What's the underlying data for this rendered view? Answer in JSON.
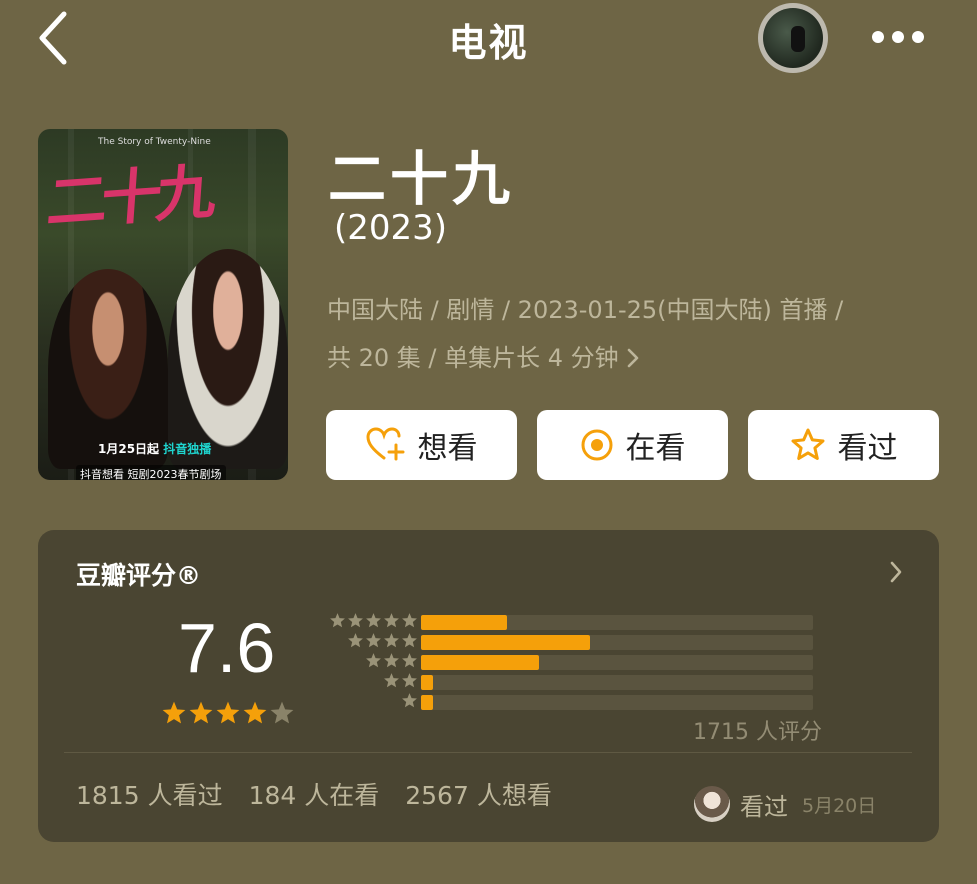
{
  "header": {
    "title": "电视",
    "back_icon": "chevron-left-icon",
    "more_icon": "ellipsis-icon"
  },
  "poster": {
    "title_art": "二十九",
    "subtitle": "The Story of Twenty-Nine",
    "release_text": "1月25日起",
    "platform_text": "抖音独播",
    "bottom_text": "抖音想看  短剧2023春节剧场"
  },
  "show": {
    "title": "二十九",
    "year": "(2023)",
    "meta_line1": "中国大陆 / 剧情 / 2023-01-25(中国大陆) 首播 /",
    "meta_line2": "共 20 集 / 单集片长 4 分钟"
  },
  "actions": [
    {
      "label": "想看",
      "icon": "heart-plus-icon"
    },
    {
      "label": "在看",
      "icon": "target-icon"
    },
    {
      "label": "看过",
      "icon": "star-outline-icon"
    }
  ],
  "rating": {
    "title": "豆瓣评分®",
    "score": "7.6",
    "score_stars": 4,
    "distribution": [
      {
        "stars": 5,
        "fraction": 0.22
      },
      {
        "stars": 4,
        "fraction": 0.43
      },
      {
        "stars": 3,
        "fraction": 0.3
      },
      {
        "stars": 2,
        "fraction": 0.03
      },
      {
        "stars": 1,
        "fraction": 0.03
      }
    ],
    "count_text": "1715 人评分",
    "stats": [
      "1815 人看过",
      "184 人在看",
      "2567 人想看"
    ],
    "friend_status": "看过",
    "friend_date": "5月20日"
  },
  "colors": {
    "background": "#6e6545",
    "card": "#4a4532",
    "accent": "#f5a00a",
    "muted_text": "#bdb69b"
  }
}
